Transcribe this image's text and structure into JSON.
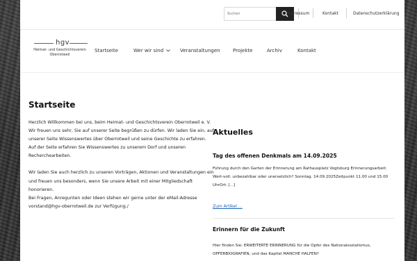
{
  "header": {
    "search": {
      "placeholder": "Suchen"
    },
    "utility_links": [
      "Impressum",
      "Kontakt",
      "Datenschutzerklärung"
    ]
  },
  "logo": {
    "mark": "hgv",
    "line1": "Heimat- und Geschichtsverein",
    "line2": "Oberrotweil"
  },
  "nav": {
    "items": [
      "Startseite",
      "Wer wir sind",
      "Veranstaltungen",
      "Projekte",
      "Archiv",
      "Kontakt"
    ]
  },
  "main": {
    "title": "Startseite",
    "paragraphs": [
      "Herzlich Willkommen bei uns, beim Heimat- und Geschichtsverein Oberrotweil e. V.",
      "Wir freuen uns sehr, Sie auf unserer Seite begrüßen zu dürfen. Wir laden Sie ein, auf unserer Seite Wissenswertes über Oberrotweil und seine Geschichte zu erfahren.",
      "Auf der Seite erfahren Sie Wissenswertes zu unserem Dorf und unseren Recherchearbeiten.",
      "Wir laden Sie auch herzlich zu unseren Vorträgen, Aktionen und Veranstaltungen ein und freuen uns besonders, wenn Sie unsere Arbeit mit einer Mitgliedschaft honorieren.",
      "Bei Fragen, Anregunten oder Ideen stehen wir gerne unter der eMail-Adresse vorstand@hgv-oberrotweil.de zur Verfügung./"
    ]
  },
  "news": {
    "heading": "Aktuelles",
    "items": [
      {
        "title": "Tag des offenen Denkmals am 14.09.2025",
        "excerpt": "Führung durch den Garten der Erinnerung am Rathausplatz Vogtsburg Erinnerungsarbeit: Wert-voll. unbezahlbar oder unersetzlich? Sonntag. 14.09.2025Zeitpunkt 11.00 und 15.00 UhrOrt: […]",
        "read_more": "Zum Artikel …"
      },
      {
        "title": "Erinnern für die Zukunft",
        "excerpt": "Hier finden Sie: ERWEITERTE ERINNERUNG für die Opfer des Nationalsozialismus, OPFERBIOGRAFIEN, und das Kapitel MANCHE HALFEN?"
      }
    ]
  },
  "colors": {
    "accent_red": "#c0392b",
    "search_button": "#222222",
    "link": "#1a5fb4"
  }
}
